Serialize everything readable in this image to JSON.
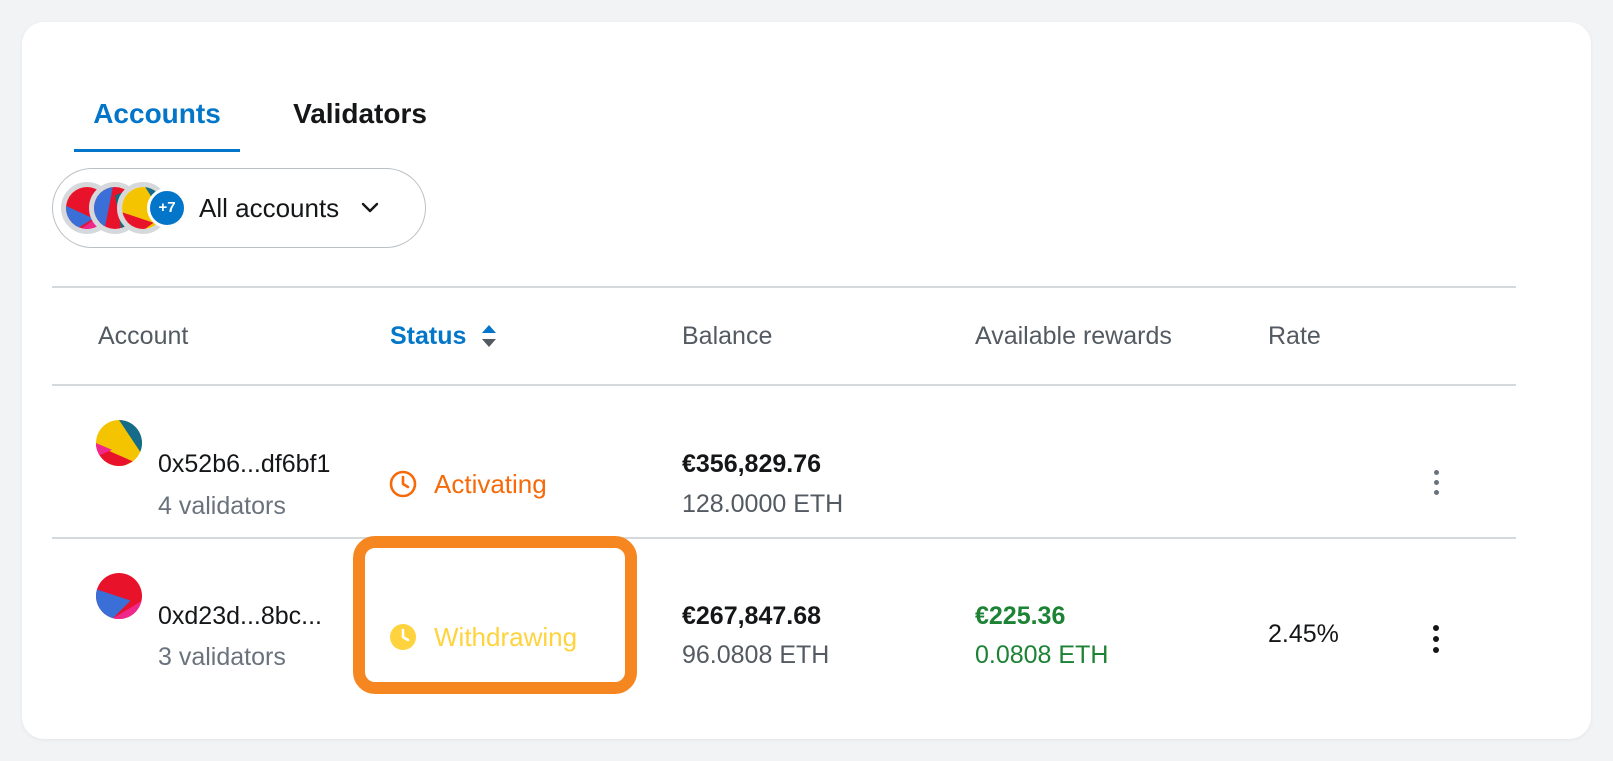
{
  "tabs": [
    {
      "label": "Accounts",
      "active": true
    },
    {
      "label": "Validators",
      "active": false
    }
  ],
  "account_selector": {
    "badge": "+7",
    "label": "All accounts"
  },
  "table": {
    "headers": {
      "account": "Account",
      "status": "Status",
      "balance": "Balance",
      "rewards": "Available rewards",
      "rate": "Rate"
    },
    "rows": [
      {
        "address": "0x52b6...df6bf1",
        "validators": "4 validators",
        "status": "Activating",
        "balance_fiat": "€356,829.76",
        "balance_eth": "128.0000 ETH",
        "rewards_fiat": "",
        "rewards_eth": "",
        "rate": ""
      },
      {
        "address": "0xd23d...8bc...",
        "validators": "3 validators",
        "status": "Withdrawing",
        "balance_fiat": "€267,847.68",
        "balance_eth": "96.0808 ETH",
        "rewards_fiat": "€225.36",
        "rewards_eth": "0.0808 ETH",
        "rate": "2.45%"
      }
    ]
  },
  "colors": {
    "accent": "#0376c9",
    "activating": "#f66a0a",
    "withdrawing": "#ffd33d",
    "rewards": "#1c8234",
    "highlight": "#f6861f"
  },
  "icons": {
    "dropdown": "chevron-down-icon",
    "sort": "sort-icon",
    "activating": "clock-outline-icon",
    "withdrawing": "clock-filled-icon",
    "row_menu": "kebab-menu-icon"
  }
}
